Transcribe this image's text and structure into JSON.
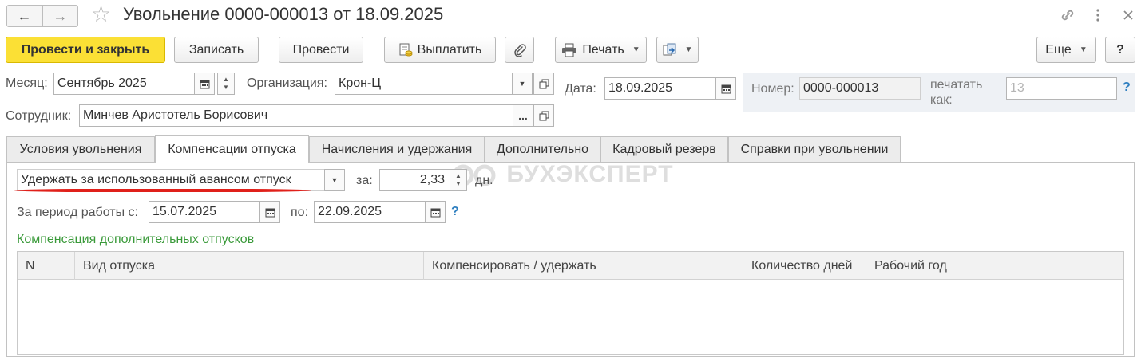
{
  "window": {
    "title": "Увольнение 0000-000013 от 18.09.2025",
    "icons": [
      "link-icon",
      "more-vertical-icon",
      "close-icon"
    ]
  },
  "nav": {
    "back_icon": "←",
    "forward_icon": "→"
  },
  "toolbar": {
    "post_and_close": "Провести и закрыть",
    "save": "Записать",
    "post": "Провести",
    "pay": "Выплатить",
    "print": "Печать",
    "more": "Еще",
    "help": "?"
  },
  "form": {
    "month_label": "Месяц:",
    "month_value": "Сентябрь 2025",
    "org_label": "Организация:",
    "org_value": "Крон-Ц",
    "date_label": "Дата:",
    "date_value": "18.09.2025",
    "number_label": "Номер:",
    "number_value": "0000-000013",
    "print_as_label_1": "печатать",
    "print_as_label_2": "как:",
    "print_as_placeholder": "13",
    "help_mark": "?",
    "employee_label": "Сотрудник:",
    "employee_value": "Минчев Аристотель Борисович",
    "ellipsis": "..."
  },
  "tabs": [
    {
      "label": "Условия увольнения",
      "active": false
    },
    {
      "label": "Компенсации отпуска",
      "active": true
    },
    {
      "label": "Начисления и удержания",
      "active": false
    },
    {
      "label": "Дополнительно",
      "active": false
    },
    {
      "label": "Кадровый резерв",
      "active": false
    },
    {
      "label": "Справки при увольнении",
      "active": false
    }
  ],
  "compensation": {
    "mode_value": "Удержать за использованный авансом отпуск",
    "for_label": "за:",
    "days_value": "2,33",
    "days_unit": "дн.",
    "period_from_label": "За период работы с:",
    "period_from_value": "15.07.2025",
    "period_to_label": "по:",
    "period_to_value": "22.09.2025",
    "help_mark": "?",
    "watermark": "БУХЭКСПЕРТ",
    "section_title": "Компенсация дополнительных отпусков"
  },
  "table": {
    "columns": [
      "N",
      "Вид отпуска",
      "Компенсировать / удержать",
      "Количество дней",
      "Рабочий год"
    ],
    "rows": []
  },
  "colors": {
    "accent": "#fbe035",
    "underline": "#e0201a",
    "section": "#3a9a3a",
    "help": "#2f7fc0"
  }
}
